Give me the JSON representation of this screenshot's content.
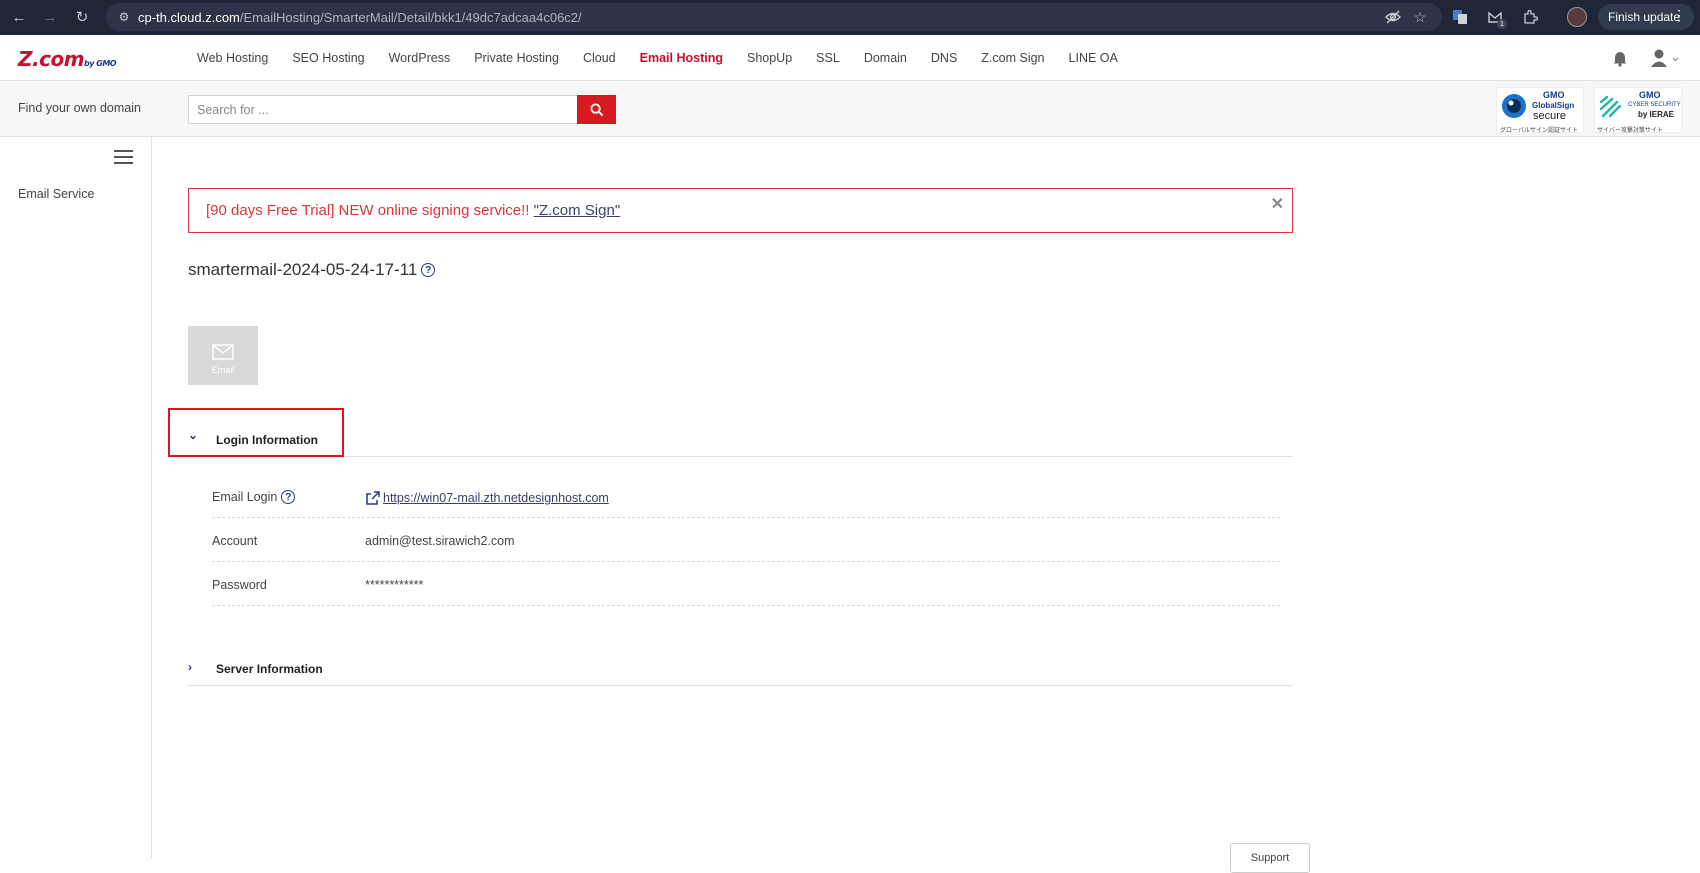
{
  "browser": {
    "url_host": "cp-th.cloud.z.com",
    "url_path": "/EmailHosting/SmarterMail/Detail/bkk1/49dc7adcaa4c06c2/",
    "finish_update_label": "Finish update",
    "ext_badge_count": "1"
  },
  "header": {
    "logo": "Z.com",
    "logo_sub": "by GMO",
    "nav": [
      {
        "label": "Web Hosting"
      },
      {
        "label": "SEO Hosting"
      },
      {
        "label": "WordPress"
      },
      {
        "label": "Private Hosting"
      },
      {
        "label": "Cloud"
      },
      {
        "label": "Email Hosting",
        "active": true
      },
      {
        "label": "ShopUp"
      },
      {
        "label": "SSL"
      },
      {
        "label": "Domain"
      },
      {
        "label": "DNS"
      },
      {
        "label": "Z.com Sign"
      },
      {
        "label": "LINE OA"
      }
    ]
  },
  "domain_search": {
    "label": "Find your own domain",
    "placeholder": "Search for ..."
  },
  "badges": {
    "globalsign": {
      "brand": "GMO",
      "name": "GlobalSign",
      "tag": "secure",
      "caption": "グローバルサイン認証サイト"
    },
    "cyber": {
      "brand": "GMO",
      "name": "CYBER SECURITY",
      "by": "by IERAE",
      "caption": "サイバー攻撃対策サイト"
    }
  },
  "sidebar": {
    "items": [
      {
        "label": "Email Service"
      }
    ]
  },
  "alert": {
    "text": "[90 days Free Trial] NEW online signing service!! ",
    "link_text": "\"Z.com Sign\"",
    "close": "✕"
  },
  "main": {
    "title": "smartermail-2024-05-24-17-11",
    "email_tile_label": "Email",
    "login_section": {
      "label": "Login Information",
      "rows": [
        {
          "label": "Email Login",
          "value": "https://win07-mail.zth.netdesignhost.com"
        },
        {
          "label": "Account",
          "value": "admin@test.sirawich2.com"
        },
        {
          "label": "Password",
          "value": "************"
        }
      ]
    },
    "server_section": {
      "label": "Server Information"
    },
    "support_label": "Support"
  },
  "colors": {
    "brand_red": "#d71920",
    "nav_active": "#c8102e",
    "accent_navy": "#2c3a7a",
    "highlight": "#e0121d"
  }
}
